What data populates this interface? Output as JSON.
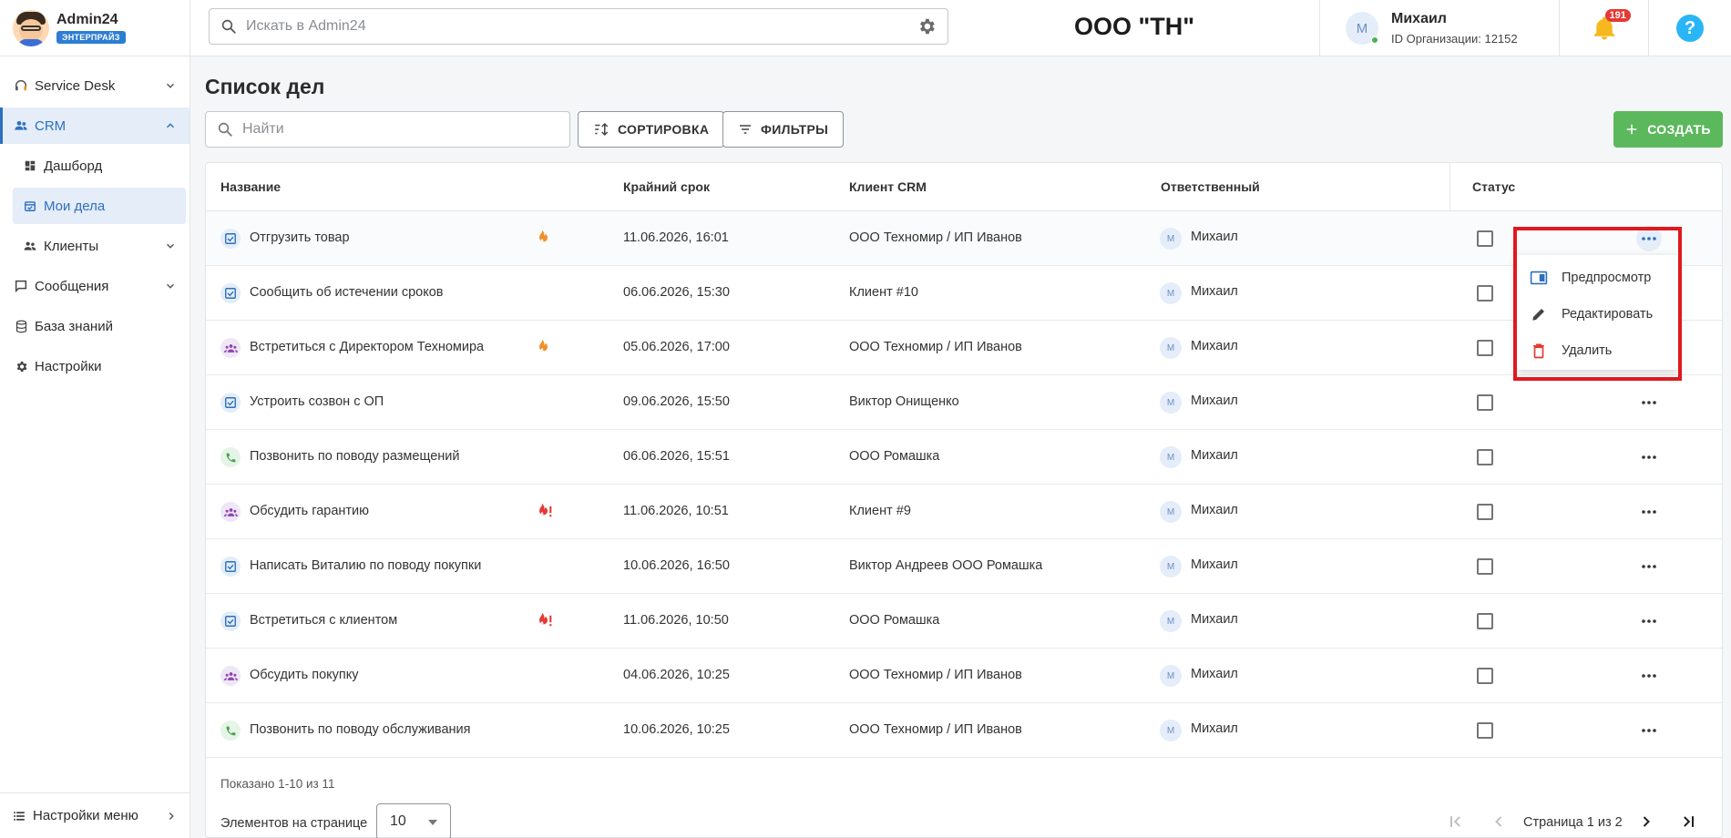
{
  "header": {
    "logo_title": "Admin24",
    "logo_badge": "ЭНТЕРПРАЙЗ",
    "search_placeholder": "Искать в Admin24",
    "org_title": "ООО \"ТН\"",
    "user_initial": "М",
    "user_name": "Михаил",
    "user_org": "ID Организации: 12152",
    "notifications_count": "191",
    "help_label": "?"
  },
  "sidebar": {
    "items": [
      {
        "label": "Service Desk"
      },
      {
        "label": "CRM"
      },
      {
        "label": "Дашборд"
      },
      {
        "label": "Мои дела"
      },
      {
        "label": "Клиенты"
      },
      {
        "label": "Сообщения"
      },
      {
        "label": "База знаний"
      },
      {
        "label": "Настройки"
      }
    ],
    "bottom_label": "Настройки меню"
  },
  "page": {
    "title": "Список дел",
    "search_placeholder": "Найти",
    "sort_label": "СОРТИРОВКА",
    "filters_label": "ФИЛЬТРЫ",
    "create_label": "СОЗДАТЬ"
  },
  "table": {
    "columns": {
      "name": "Название",
      "deadline": "Крайний срок",
      "client": "Клиент CRM",
      "responsible": "Ответственный",
      "status": "Статус"
    },
    "rows": [
      {
        "type": "task",
        "name": "Отгрузить товар",
        "priority": "hot",
        "deadline": "11.06.2026, 16:01",
        "client": "ООО Техномир / ИП Иванов",
        "resp_initial": "М",
        "responsible": "Михаил"
      },
      {
        "type": "task",
        "name": "Сообщить об истечении сроков",
        "priority": "",
        "deadline": "06.06.2026, 15:30",
        "client": "Клиент #10",
        "resp_initial": "М",
        "responsible": "Михаил"
      },
      {
        "type": "meet",
        "name": "Встретиться с Директором Техномира",
        "priority": "hot",
        "deadline": "05.06.2026, 17:00",
        "client": "ООО Техномир / ИП Иванов",
        "resp_initial": "М",
        "responsible": "Михаил"
      },
      {
        "type": "task",
        "name": "Устроить созвон с ОП",
        "priority": "",
        "deadline": "09.06.2026, 15:50",
        "client": "Виктор Онищенко",
        "resp_initial": "М",
        "responsible": "Михаил"
      },
      {
        "type": "call",
        "name": "Позвонить по поводу размещений",
        "priority": "",
        "deadline": "06.06.2026, 15:51",
        "client": "ООО Ромашка",
        "resp_initial": "М",
        "responsible": "Михаил"
      },
      {
        "type": "meet",
        "name": "Обсудить гарантию",
        "priority": "urgent",
        "deadline": "11.06.2026, 10:51",
        "client": "Клиент #9",
        "resp_initial": "М",
        "responsible": "Михаил"
      },
      {
        "type": "task",
        "name": "Написать Виталию по поводу покупки",
        "priority": "",
        "deadline": "10.06.2026, 16:50",
        "client": "Виктор Андреев ООО Ромашка",
        "resp_initial": "М",
        "responsible": "Михаил"
      },
      {
        "type": "task",
        "name": "Встретиться с клиентом",
        "priority": "urgent",
        "deadline": "11.06.2026, 10:50",
        "client": "ООО Ромашка",
        "resp_initial": "М",
        "responsible": "Михаил"
      },
      {
        "type": "meet",
        "name": "Обсудить покупку",
        "priority": "",
        "deadline": "04.06.2026, 10:25",
        "client": "ООО Техномир / ИП Иванов",
        "resp_initial": "М",
        "responsible": "Михаил"
      },
      {
        "type": "call",
        "name": "Позвонить по поводу обслуживания",
        "priority": "",
        "deadline": "10.06.2026, 10:25",
        "client": "ООО Техномир / ИП Иванов",
        "resp_initial": "М",
        "responsible": "Михаил"
      }
    ],
    "shown_text": "Показано 1-10 из 11",
    "per_page_label": "Элементов на странице",
    "per_page_value": "10",
    "page_text": "Страница 1 из 2"
  },
  "context_menu": {
    "preview": "Предпросмотр",
    "edit": "Редактировать",
    "delete": "Удалить"
  },
  "colors": {
    "accent": "#2d6fbf",
    "create": "#5cb85c",
    "highlight": "#e0181f",
    "hot": "#f0902a",
    "urgent": "#e53935"
  }
}
